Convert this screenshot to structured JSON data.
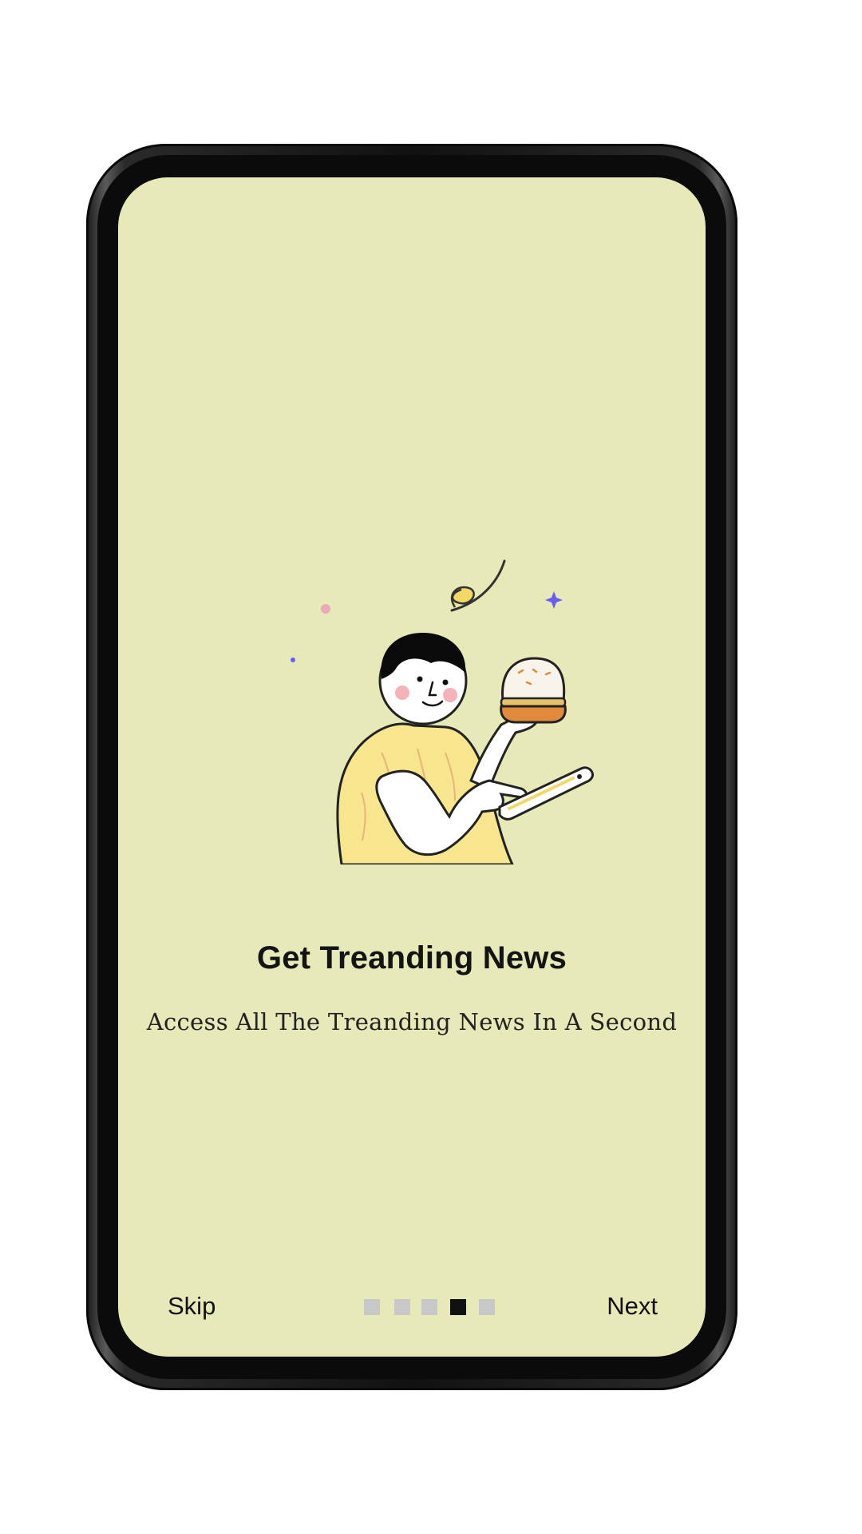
{
  "onboarding": {
    "title": "Get Treanding News",
    "subtitle": "Access All The Treanding News In A Second",
    "skip_label": "Skip",
    "next_label": "Next",
    "page_count": 5,
    "current_page": 4
  },
  "colors": {
    "screen_background": "#e8e9b8",
    "dot_inactive": "#c8c8c8",
    "dot_active": "#111111",
    "shirt": "#f7e68e",
    "sparkle": "#6a5cf0",
    "cheek": "#f4b3b8"
  },
  "illustration": {
    "subject": "person-holding-burger-using-phone"
  }
}
